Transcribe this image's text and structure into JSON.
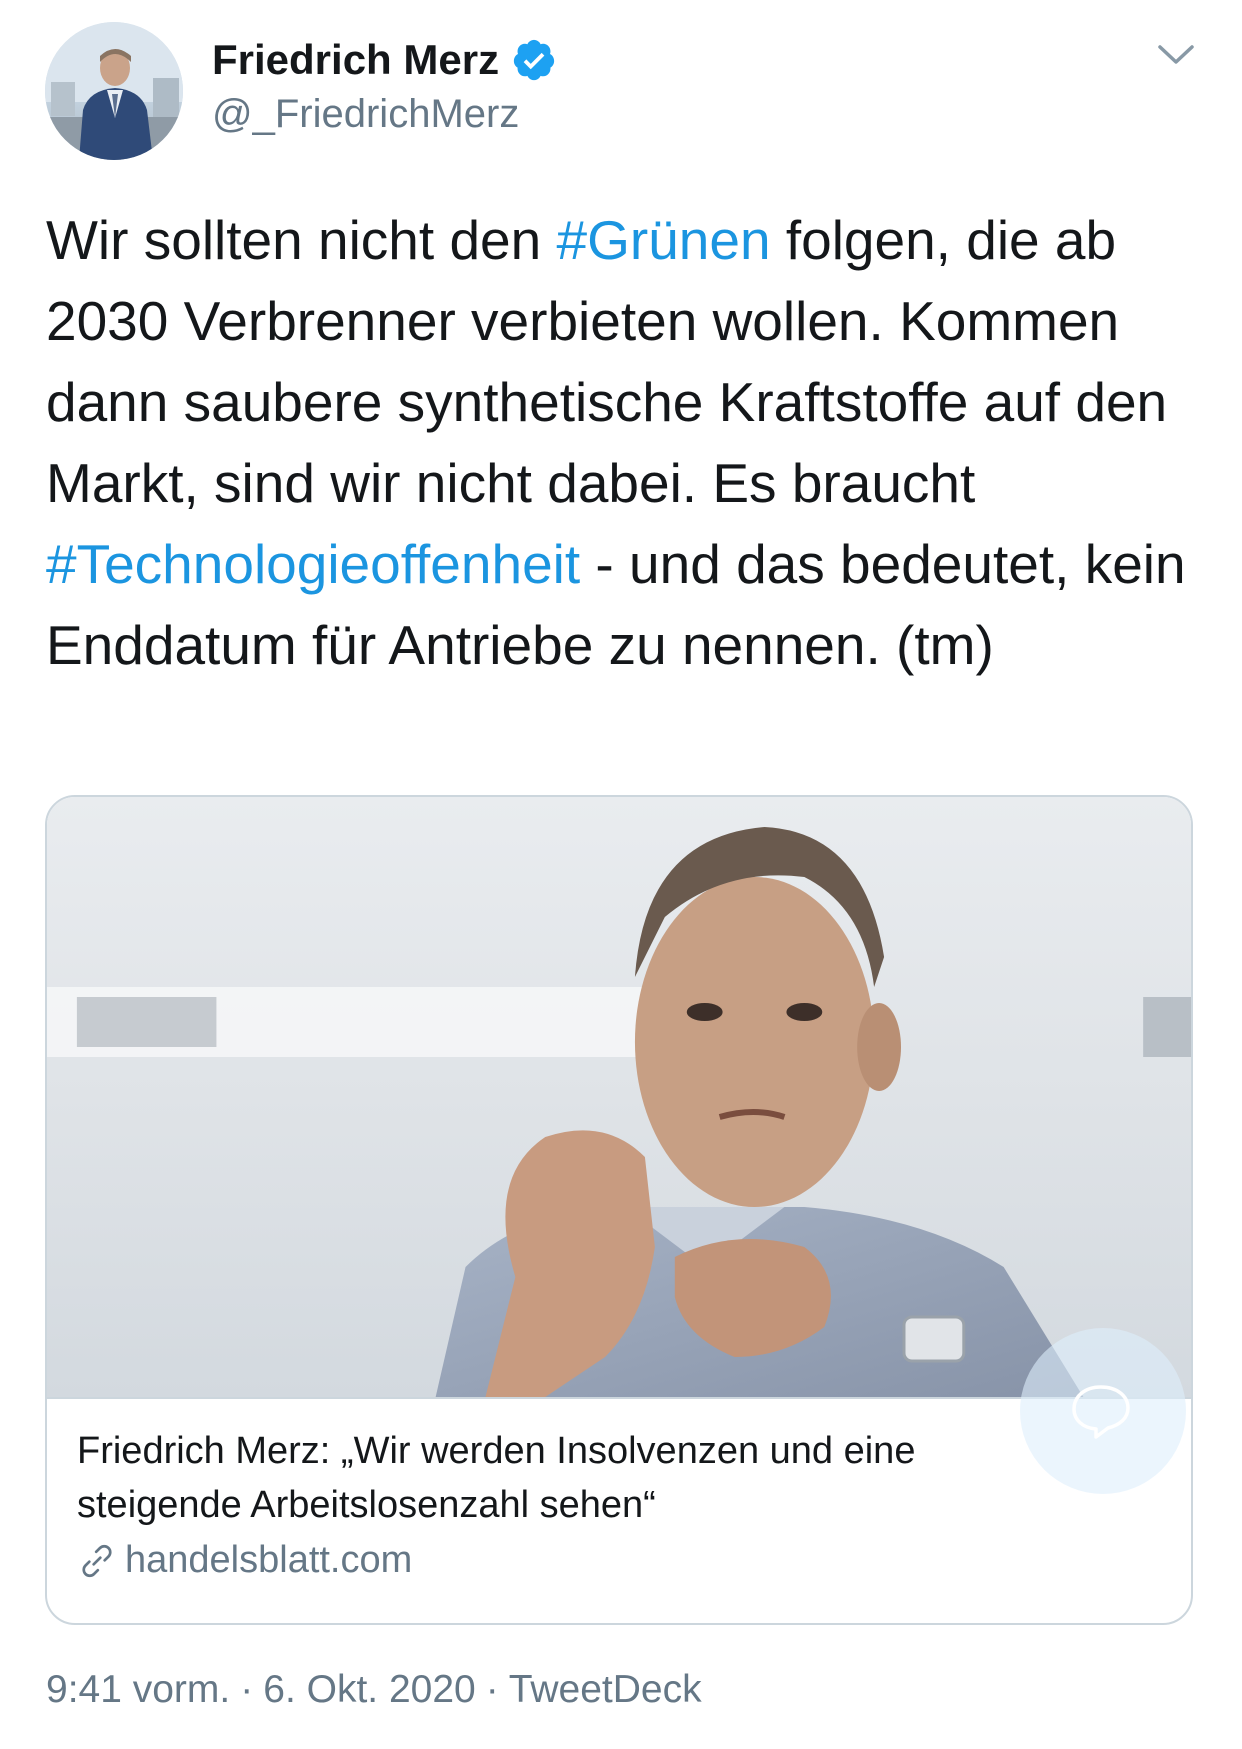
{
  "author": {
    "name": "Friedrich Merz",
    "handle": "@_FriedrichMerz",
    "avatar_icon": "profile-photo",
    "verified_icon": "verified-badge-icon",
    "verified_color": "#1da1f2"
  },
  "menu_icon": "chevron-down-icon",
  "tweet": {
    "segments": [
      {
        "text": "Wir sollten nicht den ",
        "type": "text"
      },
      {
        "text": "#Grünen",
        "type": "hashtag"
      },
      {
        "text": " folgen, die ab 2030 Verbrenner verbieten wollen. Kommen dann saubere synthetische Kraftstoffe auf den Markt, sind wir nicht dabei. Es braucht ",
        "type": "text"
      },
      {
        "text": "#Technologieoffenheit",
        "type": "hashtag"
      },
      {
        "text": " - und das bedeutet, kein Enddatum für Antriebe zu nennen. (tm)",
        "type": "text"
      }
    ]
  },
  "card": {
    "image_icon": "article-photo",
    "title": "Friedrich Merz: „Wir werden Insolvenzen und eine steigende Arbeitslosenzahl sehen“",
    "domain": "handelsblatt.com",
    "link_icon": "link-icon"
  },
  "meta": {
    "time": "9:41 vorm.",
    "date": "6. Okt. 2020",
    "source": "TweetDeck",
    "separator": "·"
  },
  "floating_icon": "reply-bubble-icon",
  "colors": {
    "text": "#14171a",
    "secondary": "#657786",
    "link": "#1b95e0",
    "border": "#ccd6dd"
  }
}
